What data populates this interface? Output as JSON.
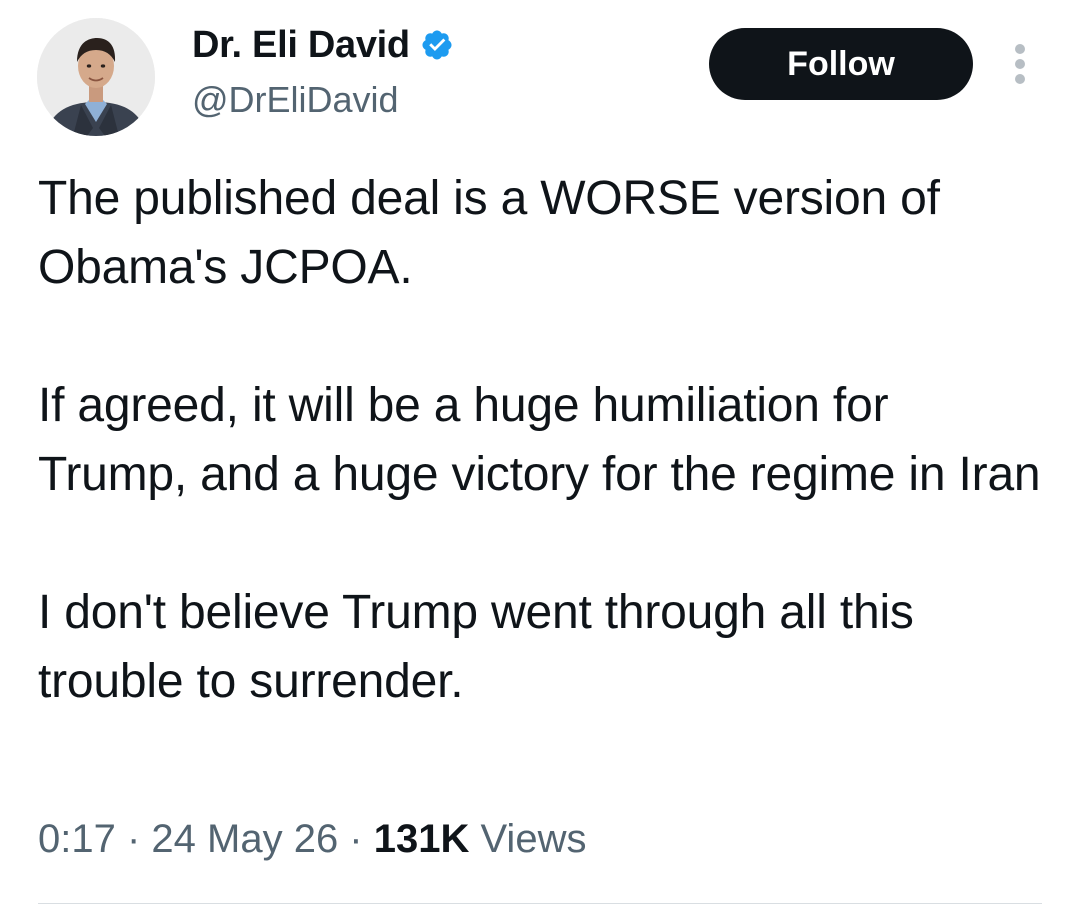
{
  "author": {
    "display_name": "Dr. Eli David",
    "handle": "@DrEliDavid",
    "verified": true,
    "verified_badge_color": "#1d9bf0",
    "avatar_icon": "profile-photo"
  },
  "actions": {
    "follow_label": "Follow",
    "more_icon": "vertical-ellipsis-icon"
  },
  "tweet": {
    "paragraphs": [
      "The published deal is a WORSE version of Obama's JCPOA.",
      "If agreed, it will be a huge humiliation for Trump, and a huge victory for the regime in Iran",
      "I don't believe Trump went through all this trouble to surrender."
    ]
  },
  "meta": {
    "time": "0:17",
    "separator": " · ",
    "date": "24 May 26",
    "views_count": "131K",
    "views_label": " Views"
  },
  "colors": {
    "text_primary": "#0f1419",
    "text_secondary": "#536471",
    "button_bg": "#0f1419",
    "button_text": "#ffffff",
    "divider": "#d9dee2"
  }
}
